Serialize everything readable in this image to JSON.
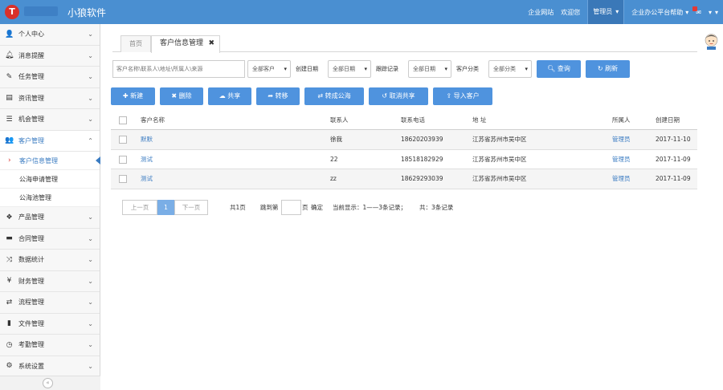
{
  "header": {
    "app_name": "小狼软件",
    "links": [
      "企业网站",
      "欢迎您"
    ],
    "admin": "管理员",
    "help": "企业办公平台帮助"
  },
  "sidebar": {
    "items": [
      {
        "label": "个人中心",
        "icon": "user-icon"
      },
      {
        "label": "消息提醒",
        "icon": "bell-icon"
      },
      {
        "label": "任务管理",
        "icon": "edit-icon"
      },
      {
        "label": "资讯管理",
        "icon": "news-icon"
      },
      {
        "label": "机会管理",
        "icon": "list-icon"
      },
      {
        "label": "客户管理",
        "icon": "users-icon"
      },
      {
        "label": "产品管理",
        "icon": "dropbox-icon"
      },
      {
        "label": "合同管理",
        "icon": "drive-icon"
      },
      {
        "label": "数据统计",
        "icon": "shuffle-icon"
      },
      {
        "label": "财务管理",
        "icon": "yen-icon"
      },
      {
        "label": "流程管理",
        "icon": "retweet-icon"
      },
      {
        "label": "文件管理",
        "icon": "file-icon"
      },
      {
        "label": "考勤管理",
        "icon": "clock-icon"
      },
      {
        "label": "系统设置",
        "icon": "gear-icon"
      }
    ],
    "sub_items": [
      "客户信息管理",
      "公海申请管理",
      "公海池管理"
    ]
  },
  "tabs": {
    "home": "首页",
    "active": "客户信息管理"
  },
  "filters": {
    "search_placeholder": "客户名称\\联系人\\地址\\所属人\\来源",
    "customer_select": "全部客户",
    "created_label": "创建日期",
    "created_select": "全部日期",
    "follow_label": "跟踪记录",
    "follow_select": "全部日期",
    "category_label": "客户分类",
    "category_select": "全部分类",
    "query": "查询",
    "refresh": "刷新"
  },
  "actions": [
    "新建",
    "删除",
    "共享",
    "转移",
    "转成公海",
    "取消共享",
    "导入客户"
  ],
  "table": {
    "headers": [
      "客户名称",
      "联系人",
      "联系电话",
      "地 址",
      "所属人",
      "创建日期"
    ],
    "rows": [
      [
        "默默",
        "徐我",
        "18620203939",
        "江苏省苏州市吴中区",
        "管理员",
        "2017-11-10"
      ],
      [
        "测试",
        "22",
        "18518182929",
        "江苏省苏州市吴中区",
        "管理员",
        "2017-11-09"
      ],
      [
        "测试",
        "zz",
        "18629293039",
        "江苏省苏州市吴中区",
        "管理员",
        "2017-11-09"
      ]
    ]
  },
  "pager": {
    "prev": "上一页",
    "page": "1",
    "next": "下一页",
    "total_pages": "共1页",
    "goto": "跳到第",
    "page_unit": "页",
    "confirm": "确定",
    "current_display": "当前显示：1——3条记录；",
    "total_records": "共：3条记录"
  },
  "colors": {
    "topbar": "#4a8fd1",
    "accent": "#4f93de",
    "logo": "#d9302a"
  }
}
